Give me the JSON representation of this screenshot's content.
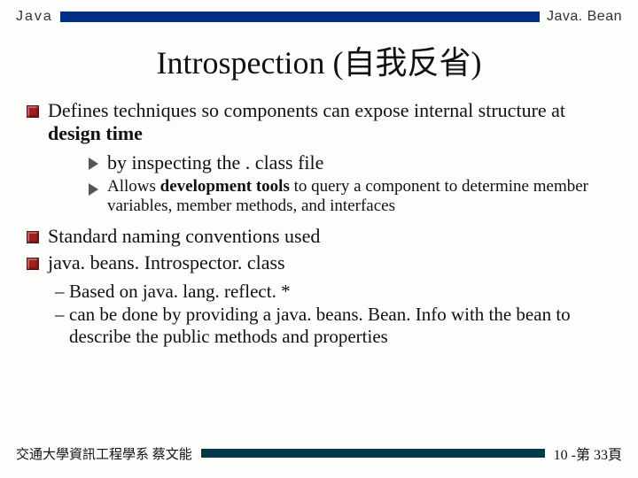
{
  "header": {
    "left": "Java",
    "right": "Java. Bean"
  },
  "title": "Introspection (自我反省)",
  "bullets": [
    {
      "text": "Defines techniques so components can expose internal structure at ",
      "bold": "design time",
      "sub": [
        {
          "kind": "big",
          "text": "by inspecting the . class file"
        },
        {
          "kind": "small",
          "pre": "Allows ",
          "bold": "development tools",
          "post": " to query a component to determine member variables, member methods, and interfaces"
        }
      ]
    },
    {
      "text": "Standard naming conventions used"
    },
    {
      "text": "java. beans. Introspector. class",
      "dash": [
        "Based on java. lang. reflect. *",
        "can be done by providing a java. beans. Bean. Info  with the bean to describe the public methods and properties"
      ]
    }
  ],
  "footer": {
    "left": "交通大學資訊工程學系 蔡文能",
    "right": "10 -第 33頁"
  }
}
